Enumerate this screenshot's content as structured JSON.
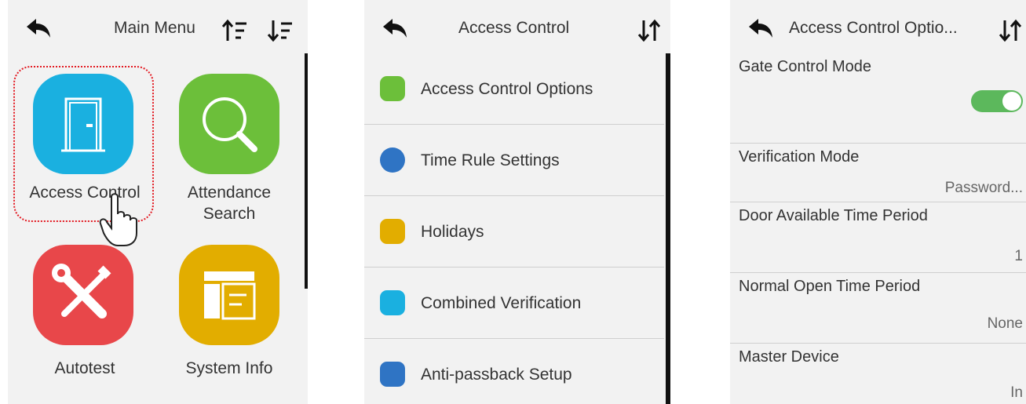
{
  "screens": {
    "main_menu": {
      "title": "Main Menu",
      "items": [
        {
          "label": "Access Control",
          "icon": "door-icon",
          "color": "#1ab0e0"
        },
        {
          "label": "Attendance\nSearch",
          "icon": "magnifier-icon",
          "color": "#6cbf3a"
        },
        {
          "label": "Autotest",
          "icon": "tools-icon",
          "color": "#e8474a"
        },
        {
          "label": "System Info",
          "icon": "info-window-icon",
          "color": "#e2ad00"
        }
      ]
    },
    "access_control": {
      "title": "Access Control",
      "items": [
        {
          "label": "Access Control Options",
          "icon": "door-icon",
          "color": "#6cbf3a"
        },
        {
          "label": "Time Rule Settings",
          "icon": "clock-icon",
          "color": "#2f74c4"
        },
        {
          "label": "Holidays",
          "icon": "balloon-icon",
          "color": "#e2ad00"
        },
        {
          "label": "Combined Verification",
          "icon": "lock-icon",
          "color": "#1ab0e0"
        },
        {
          "label": "Anti-passback Setup",
          "icon": "people-icon",
          "color": "#2f74c4"
        }
      ]
    },
    "access_options": {
      "title": "Access Control Optio...",
      "options": [
        {
          "label": "Gate Control Mode",
          "value": "",
          "toggle_on": true
        },
        {
          "label": "Verification Mode",
          "value": "Password..."
        },
        {
          "label": "Door Available Time Period",
          "value": "1"
        },
        {
          "label": "Normal Open Time Period",
          "value": "None"
        },
        {
          "label": "Master Device",
          "value": "In"
        }
      ]
    }
  },
  "colors": {
    "toggle_on": "#5cb85c",
    "selection": "#e31b23"
  }
}
